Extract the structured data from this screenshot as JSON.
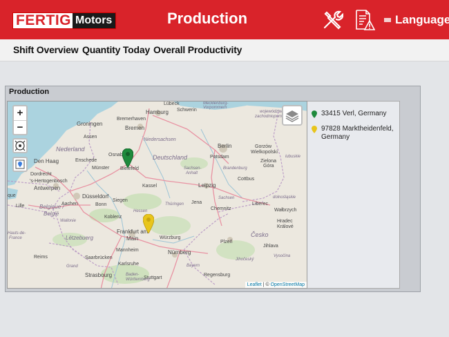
{
  "brand": {
    "logo_main": "FERTIG",
    "logo_sub": "Motors"
  },
  "header": {
    "title": "Production",
    "language_label": "Language"
  },
  "icons": {
    "tools": "tools-icon",
    "report": "report-warning-icon",
    "flag": "flag-icon"
  },
  "nav": {
    "items": [
      {
        "label": "Shift Overview"
      },
      {
        "label": "Quantity Today"
      },
      {
        "label": "Overall Productivity"
      }
    ]
  },
  "panel": {
    "title": "Production"
  },
  "map": {
    "zoom_in": "+",
    "zoom_out": "−",
    "attribution_leaflet": "Leaflet",
    "attribution_sep": " | © ",
    "attribution_osm": "OpenStreetMap",
    "labels": {
      "lubeck": "Lübeck",
      "hamburg": "Hamburg",
      "schwerin": "Schwerin",
      "mecklenburg": "Mecklenburg-",
      "vorpommern": "Vorpommern",
      "groningen": "Groningen",
      "bremerhaven": "Bremerhaven",
      "bremen": "Bremen",
      "niedersachsen": "Niedersachsen",
      "assen": "Assen",
      "nederland": "Nederland",
      "den_haag": "Den Haag",
      "enschede": "Enschede",
      "osnabruck": "Osnabrück",
      "munster": "Münster",
      "bielefeld": "Bielefeld",
      "dordrecht": "Dordrecht",
      "hertogenbosch": "'s-Hertogenbosch",
      "deutschland": "Deutschland",
      "berlin": "Berlin",
      "potsdam": "Potsdam",
      "brandenburg": "Brandenburg",
      "gorzow": "Gorzów",
      "wielkopolski": "Wielkopolski",
      "zielona": "Zielona",
      "gora": "Góra",
      "cottbus": "Cottbus",
      "sachsen_anhalt": "Sachsen-",
      "anhalt": "Anhalt",
      "leipzig": "Leipzig",
      "kassel": "Kassel",
      "antwerpen": "Antwerpen",
      "dusseldorf": "Düsseldorf",
      "aachen": "Aachen",
      "bonn": "Bonn",
      "siegen": "Siegen",
      "lille": "Lille",
      "belgique": "Belgique /",
      "belgie": "België",
      "wallonie": "Wallonie",
      "koblenz": "Koblenz",
      "hessen": "Hessen",
      "thuringen": "Thüringen",
      "jena": "Jena",
      "sachsen": "Sachsen",
      "chemnitz": "Chemnitz",
      "liberec": "Liberec",
      "walbrzych": "Wałbrzych",
      "hradec": "Hradec",
      "kralove": "Králové",
      "dolnoslaskie": "dolnośląskie",
      "frankfurt": "Frankfurt am",
      "main": "Main",
      "wurzburg": "Würzburg",
      "letzebuerg": "Lëtzebuerg",
      "mannheim": "Mannheim",
      "nurnberg": "Nürnberg",
      "plzen": "Plzeň",
      "cesko": "Česko",
      "jihlava": "Jihlava",
      "reims": "Reims",
      "saarbrucken": "Saarbrücken",
      "karlsruhe": "Karlsruhe",
      "strasbourg": "Strasbourg",
      "grand_est": "Grand",
      "stuttgart": "Stuttgart",
      "baden": "Baden-",
      "wurttemberg": "Württemberg",
      "bayern": "Bayern",
      "regensburg": "Regensburg",
      "jihocesky": "Jihočeský",
      "vysocina": "Vysočina",
      "hauts": "Hauts-de-",
      "france": "France",
      "zachodnio": "zachodniopomorskie",
      "lubuskie": "lubuskie",
      "wielkop": "województwo",
      "ue": "que"
    }
  },
  "locations": [
    {
      "label": "33415 Verl, Germany",
      "color": "#1e8a3c"
    },
    {
      "label": "97828 Marktheidenfeld, Germany",
      "color": "#e8c51c"
    }
  ],
  "colors": {
    "brand_red": "#d9232a",
    "nav_bg": "#f2f2f2",
    "panel_bg": "#c9ccd1"
  }
}
